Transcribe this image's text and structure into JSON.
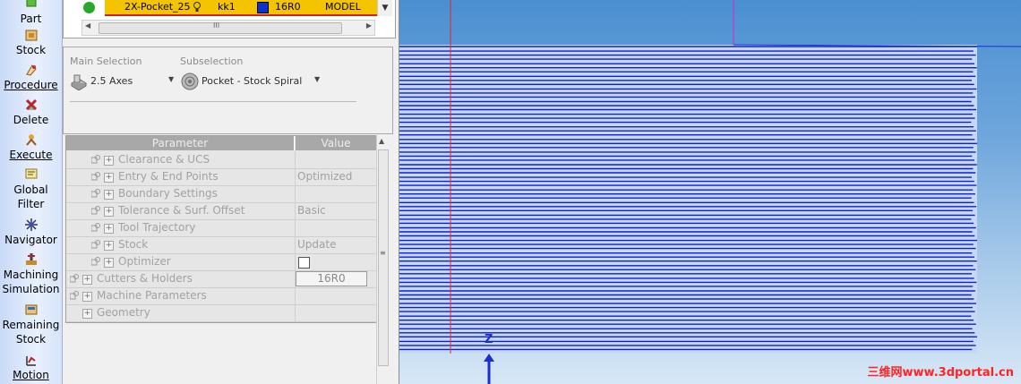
{
  "sidebar": {
    "items": [
      {
        "label": "Part",
        "icon": "part-icon"
      },
      {
        "label": "Stock",
        "icon": "stock-icon"
      },
      {
        "label": "Procedure",
        "icon": "procedure-icon"
      },
      {
        "label": "Delete",
        "icon": "delete-icon"
      },
      {
        "label": "Execute",
        "icon": "execute-icon"
      },
      {
        "label": "Global",
        "label2": "Filter",
        "icon": "global-filter-icon"
      },
      {
        "label": "Navigator",
        "icon": "navigator-icon"
      },
      {
        "label": "Machining",
        "label2": "Simulation",
        "icon": "machining-simulation-icon"
      },
      {
        "label": "Remaining",
        "label2": "Stock",
        "icon": "remaining-stock-icon"
      },
      {
        "label": "Motion",
        "icon": "motion-icon"
      }
    ]
  },
  "operation": {
    "name": "2X-Pocket_25",
    "tool": "kk1",
    "cutter": "16R0",
    "coordinate": "MODEL",
    "scroll_left": "◀",
    "scroll_right": "▶",
    "scroll_grip": "III"
  },
  "selection": {
    "main_label": "Main Selection",
    "main_value": "2.5 Axes",
    "sub_label": "Subselection",
    "sub_value": "Pocket - Stock Spiral"
  },
  "parameters": {
    "header_name": "Parameter",
    "header_value": "Value",
    "rows": [
      {
        "name": "Clearance & UCS",
        "value": "",
        "level": 1
      },
      {
        "name": "Entry & End Points",
        "value": "Optimized",
        "level": 1
      },
      {
        "name": "Boundary Settings",
        "value": "",
        "level": 1
      },
      {
        "name": "Tolerance & Surf. Offset",
        "value": "Basic",
        "level": 1
      },
      {
        "name": "Tool Trajectory",
        "value": "",
        "level": 1
      },
      {
        "name": "Stock",
        "value": "Update",
        "level": 1
      },
      {
        "name": "Optimizer",
        "value": "",
        "level": 1,
        "checkbox": true
      },
      {
        "name": "Cutters & Holders",
        "value": "16R0",
        "level": 0,
        "button": true
      },
      {
        "name": "Machine Parameters",
        "value": "",
        "level": 0
      },
      {
        "name": "Geometry",
        "value": "",
        "level": 0,
        "noicon": true
      }
    ]
  },
  "viewport": {
    "axis_label": "Z",
    "watermark": "三维网www.3dportal.cn",
    "toolpath_color": "#0a1fd6",
    "background_top": "#4b8fd1",
    "background_bottom": "#d7e7f6"
  },
  "colors": {
    "operation_row": "#f5c400",
    "operation_underline": "#d02020",
    "sidebar": "#dbe6f9"
  }
}
